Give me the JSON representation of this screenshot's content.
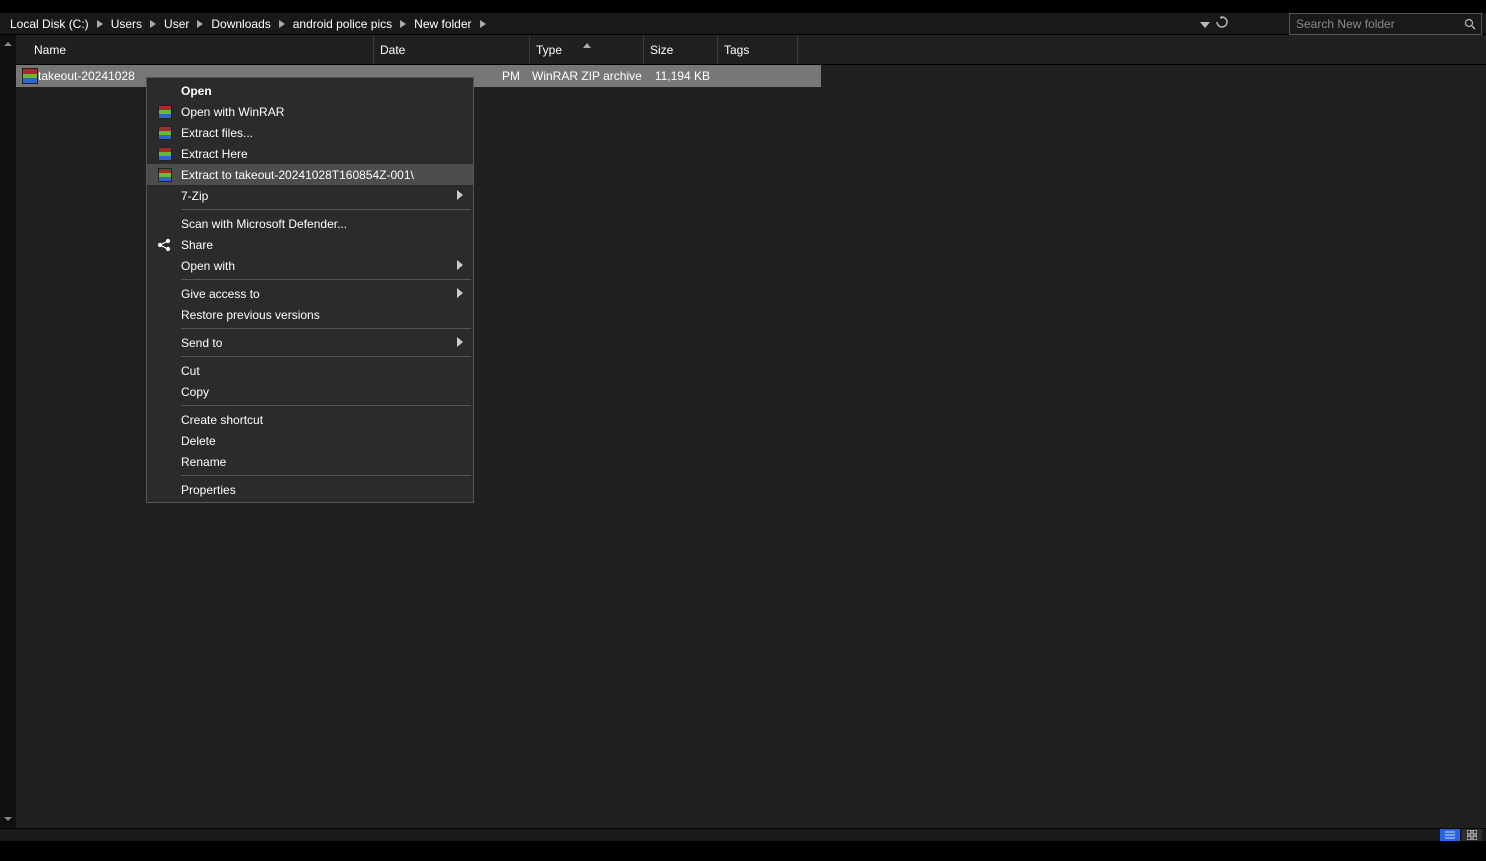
{
  "breadcrumb": {
    "items": [
      "Local Disk (C:)",
      "Users",
      "User",
      "Downloads",
      "android police pics",
      "New folder"
    ]
  },
  "search": {
    "placeholder": "Search New folder"
  },
  "columns": {
    "name": "Name",
    "date": "Date",
    "type": "Type",
    "size": "Size",
    "tags": "Tags"
  },
  "files": [
    {
      "name": "takeout-20241028",
      "date_suffix": "PM",
      "type": "WinRAR ZIP archive",
      "size": "11,194 KB"
    }
  ],
  "context_menu": {
    "open": "Open",
    "open_with_winrar": "Open with WinRAR",
    "extract_files": "Extract files...",
    "extract_here": "Extract Here",
    "extract_to_folder": "Extract to takeout-20241028T160854Z-001\\",
    "seven_zip": "7-Zip",
    "scan_defender": "Scan with Microsoft Defender...",
    "share": "Share",
    "open_with": "Open with",
    "give_access_to": "Give access to",
    "restore_versions": "Restore previous versions",
    "send_to": "Send to",
    "cut": "Cut",
    "copy": "Copy",
    "create_shortcut": "Create shortcut",
    "delete": "Delete",
    "rename": "Rename",
    "properties": "Properties"
  }
}
